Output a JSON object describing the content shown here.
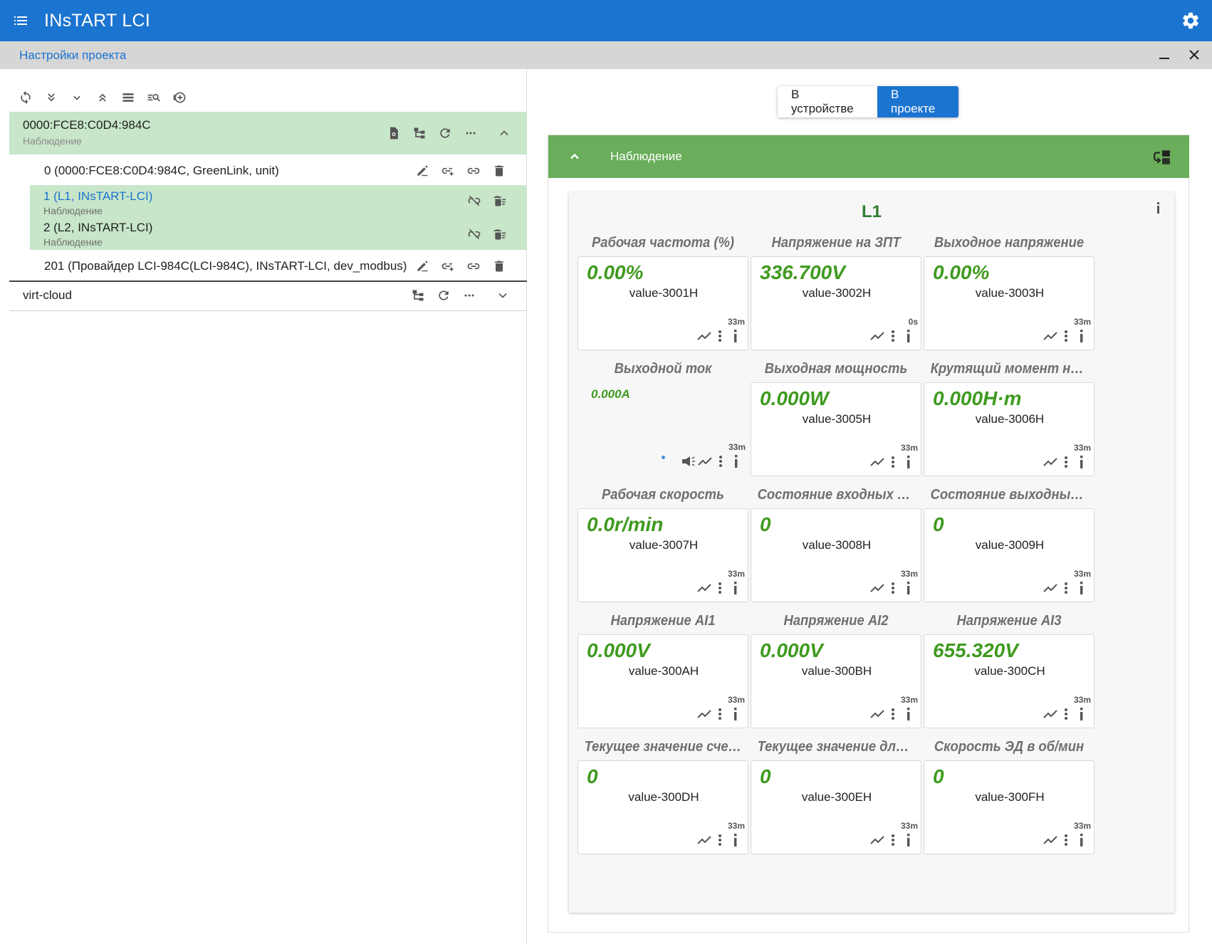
{
  "app": {
    "title": "INsTART LCI",
    "menu_icon": "menu-icon",
    "settings_icon": "gear-icon"
  },
  "subbar": {
    "title": "Настройки проекта"
  },
  "toolbar": {
    "icons": [
      "refresh-icon",
      "expand-all-icon",
      "expand-icon",
      "collapse-all-icon",
      "list-view-icon",
      "search-list-icon",
      "add-circle-icon"
    ]
  },
  "tree": {
    "root": {
      "title": "0000:FCE8:C0D4:984C",
      "subtitle": "Наблюдение"
    },
    "children": [
      {
        "label": "0 (0000:FCE8:C0D4:984C, GreenLink, unit)"
      },
      {
        "label": "1 (L1, INsTART-LCI)",
        "subtitle": "Наблюдение",
        "link_color": "#1b74d0"
      },
      {
        "label": "2 (L2, INsTART-LCI)",
        "subtitle": "Наблюдение"
      },
      {
        "label": "201 (Провайдер LCI-984C(LCI-984C), INsTART-LCI, dev_modbus)"
      }
    ],
    "second_root": {
      "title": "virt-cloud"
    }
  },
  "view_toggle": {
    "device": "В устройстве",
    "project": "В проекте",
    "active": "project"
  },
  "panel": {
    "title": "Наблюдение"
  },
  "card": {
    "title": "L1",
    "tiles": [
      {
        "label": "Рабочая частота (%)",
        "value": "0.00%",
        "var": "value-3001H",
        "age": "33m"
      },
      {
        "label": "Напряжение на ЗПТ",
        "value": "336.700V",
        "var": "value-3002H",
        "age": "0s"
      },
      {
        "label": "Выходное напряжение",
        "value": "0.00%",
        "var": "value-3003H",
        "age": "33m"
      },
      {
        "label": "Выходной ток",
        "value": "0.000A",
        "var": "",
        "age": "33m",
        "plain": true
      },
      {
        "label": "Выходная мощность",
        "value": "0.000W",
        "var": "value-3005H",
        "age": "33m"
      },
      {
        "label": "Крутящий момент на вы...",
        "value": "0.000Н·m",
        "var": "value-3006H",
        "age": "33m"
      },
      {
        "label": "Рабочая скорость",
        "value": "0.0r/min",
        "var": "value-3007H",
        "age": "33m"
      },
      {
        "label": "Состояние входных кле...",
        "value": "0",
        "var": "value-3008H",
        "age": "33m"
      },
      {
        "label": "Состояние выходных кл...",
        "value": "0",
        "var": "value-3009H",
        "age": "33m"
      },
      {
        "label": "Напряжение AI1",
        "value": "0.000V",
        "var": "value-300AH",
        "age": "33m"
      },
      {
        "label": "Напряжение AI2",
        "value": "0.000V",
        "var": "value-300BH",
        "age": "33m"
      },
      {
        "label": "Напряжение AI3",
        "value": "655.320V",
        "var": "value-300CH",
        "age": "33m"
      },
      {
        "label": "Текущее значение счетч...",
        "value": "0",
        "var": "value-300DH",
        "age": "33m"
      },
      {
        "label": "Текущее значение длин...",
        "value": "0",
        "var": "value-300EH",
        "age": "33m"
      },
      {
        "label": "Скорость ЭД в об/мин",
        "value": "0",
        "var": "value-300FH",
        "age": "33m"
      }
    ]
  },
  "colors": {
    "primary": "#1b74d0",
    "panel_header": "#6aad5a",
    "selected_row": "#c8e6c9",
    "value_green": "#3f9a1f",
    "title_green": "#2e7d32"
  }
}
